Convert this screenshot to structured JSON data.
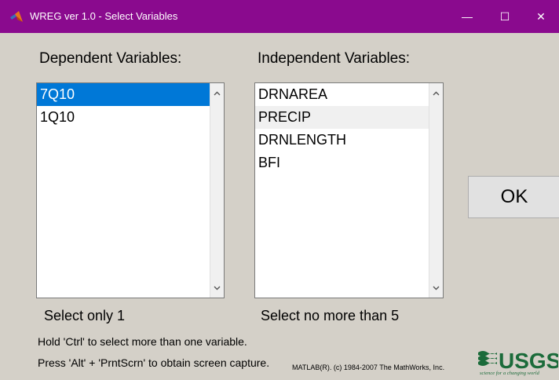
{
  "window": {
    "title": "WREG ver 1.0 - Select Variables",
    "icon": "matlab-icon",
    "controls": {
      "minimize": "—",
      "maximize": "☐",
      "close": "✕"
    },
    "title_bar_color": "#8a0a8e"
  },
  "dependent": {
    "label": "Dependent Variables:",
    "items": [
      {
        "label": "7Q10",
        "selected": true
      },
      {
        "label": "1Q10",
        "selected": false
      }
    ],
    "hint": "Select only 1"
  },
  "independent": {
    "label": "Independent Variables:",
    "items": [
      {
        "label": "DRNAREA"
      },
      {
        "label": "PRECIP"
      },
      {
        "label": "DRNLENGTH"
      },
      {
        "label": "BFI"
      }
    ],
    "hint": "Select no more than 5"
  },
  "ok_button": {
    "label": "OK"
  },
  "notes": {
    "ctrl": "Hold 'Ctrl' to select more than one variable.",
    "capture": "Press 'Alt' + 'PrntScrn' to obtain screen capture."
  },
  "copyright": "MATLAB(R). (c) 1984-2007 The MathWorks, Inc.",
  "logo": {
    "text": "USGS",
    "tagline": "science for a changing world",
    "color": "#1b6b3a"
  },
  "colors": {
    "selection": "#0078d7",
    "background": "#d4d0c8"
  }
}
